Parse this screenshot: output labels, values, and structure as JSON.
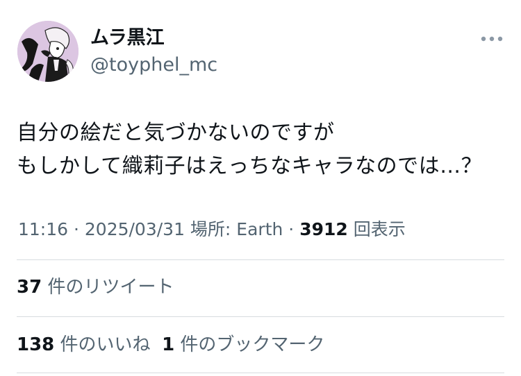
{
  "user": {
    "display_name": "ムラ黒江",
    "handle": "@toyphel_mc",
    "avatar_icon": "manga-character-avatar"
  },
  "more_icon": "ellipsis-horizontal-icon",
  "tweet": {
    "text": "自分の絵だと気づかないのですが\nもしかして織莉子はえっちなキャラなのでは…？"
  },
  "meta": {
    "time": "11:16",
    "sep1": " · ",
    "date": "2025/03/31",
    "location": " 場所: Earth",
    "sep2": " · ",
    "views_count": "3912",
    "views_label": " 回表示"
  },
  "stats": {
    "retweets_count": "37",
    "retweets_label": " 件のリツイート",
    "likes_count": "138",
    "likes_label": " 件のいいね",
    "bookmarks_count": "1",
    "bookmarks_label": " 件のブックマーク"
  },
  "colors": {
    "text": "#0f1419",
    "secondary": "#536471",
    "divider": "#d7dbdf",
    "avatar_bg": "#d9c3df"
  }
}
